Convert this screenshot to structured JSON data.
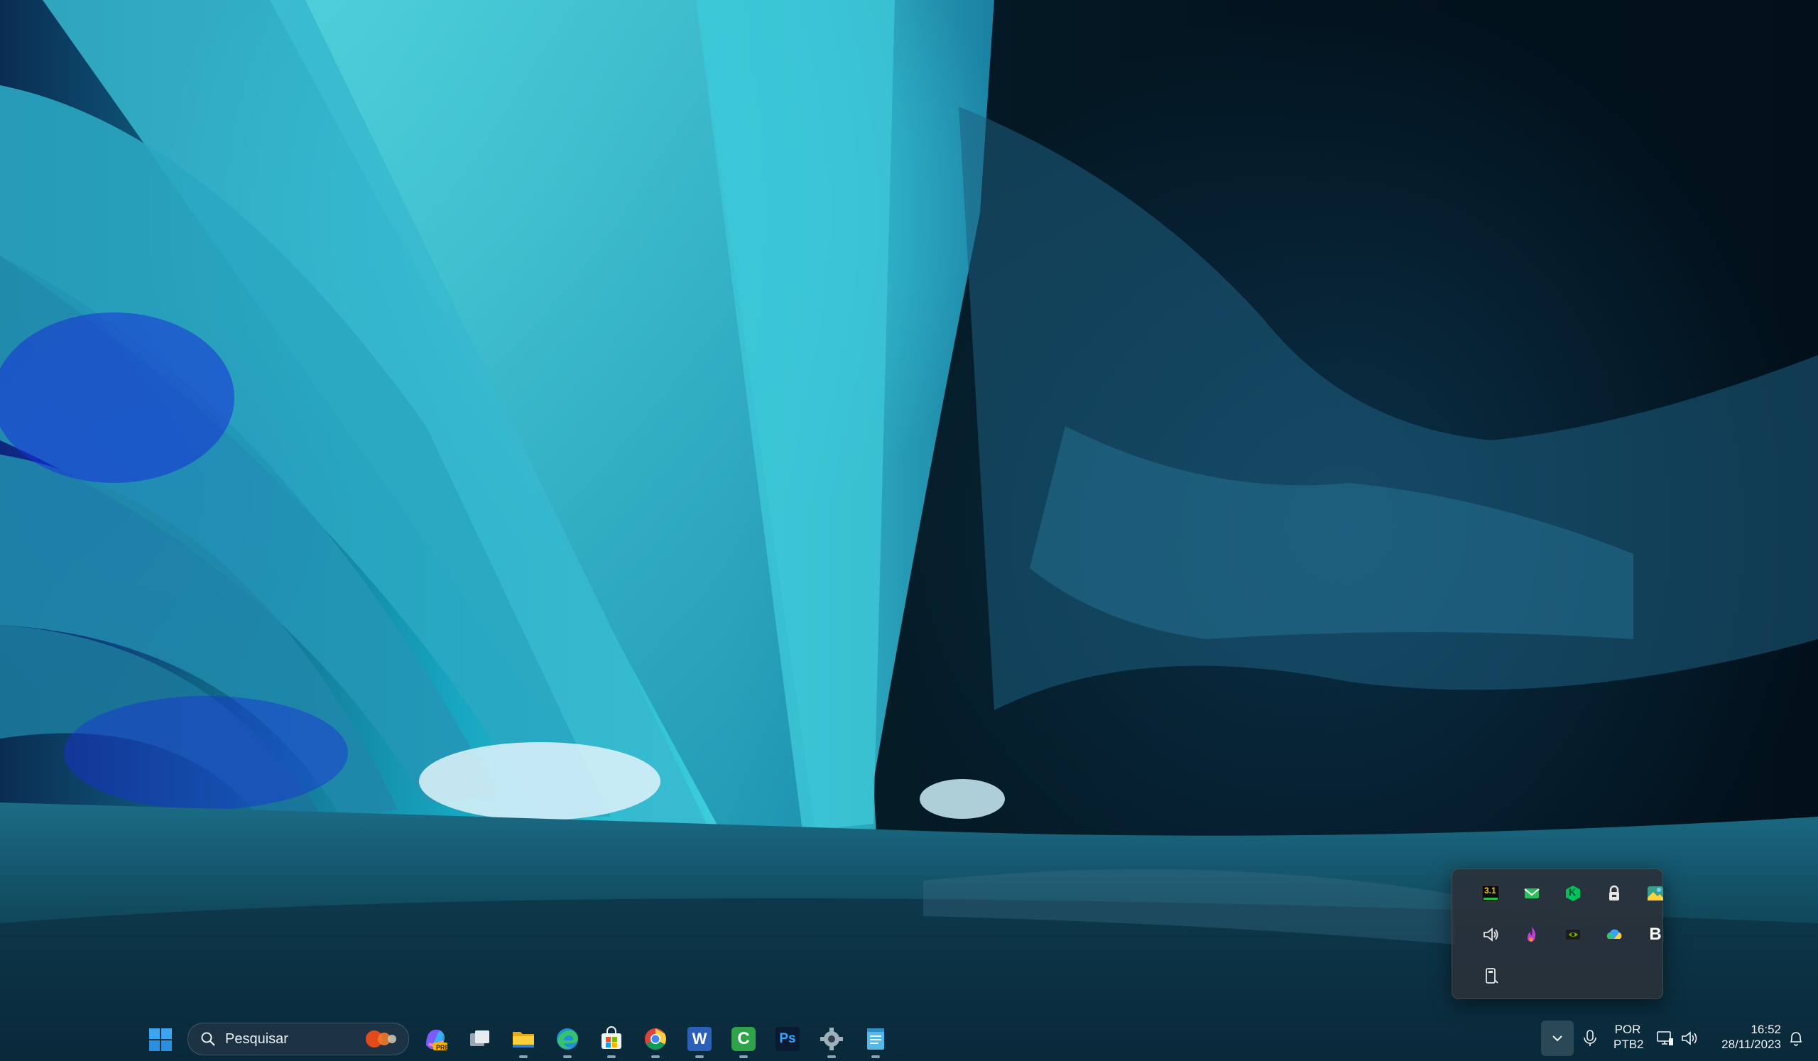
{
  "taskbar": {
    "search_placeholder": "Pesquisar",
    "pinned_apps": [
      {
        "name": "Copilot Preview",
        "icon": "copilot-pre-icon",
        "badge": "PRE"
      },
      {
        "name": "Task View",
        "icon": "task-view-icon"
      },
      {
        "name": "File Explorer",
        "icon": "folder-icon"
      },
      {
        "name": "Microsoft Edge",
        "icon": "edge-icon"
      },
      {
        "name": "Microsoft Store",
        "icon": "store-icon"
      },
      {
        "name": "Google Chrome",
        "icon": "chrome-icon"
      },
      {
        "name": "Microsoft Word",
        "icon": "word-icon",
        "label": "W"
      },
      {
        "name": "Camtasia",
        "icon": "camtasia-icon",
        "label": "C"
      },
      {
        "name": "Adobe Photoshop",
        "icon": "photoshop-icon",
        "label": "Ps"
      },
      {
        "name": "Settings",
        "icon": "gear-icon"
      },
      {
        "name": "Notepad",
        "icon": "notepad-icon"
      }
    ]
  },
  "tray_flyout": {
    "icons": [
      {
        "icon": "task-manager-icon",
        "label": "3.1"
      },
      {
        "icon": "mail-icon"
      },
      {
        "icon": "kaspersky-icon",
        "label": "K"
      },
      {
        "icon": "vpn-lock-icon"
      },
      {
        "icon": "photos-icon"
      },
      {
        "icon": "speaker-icon"
      },
      {
        "icon": "flame-app-icon"
      },
      {
        "icon": "nvidia-icon"
      },
      {
        "icon": "cloud-sync-icon"
      },
      {
        "icon": "bold-b-app-icon",
        "label": "B"
      },
      {
        "icon": "usb-drive-icon"
      }
    ]
  },
  "system_tray": {
    "language_line1": "POR",
    "language_line2": "PTB2",
    "time": "16:52",
    "date": "28/11/2023"
  },
  "colors": {
    "taskbar_text": "#f2f4f6",
    "flyout_bg": "#2a323a",
    "accent_blue": "#2b7fd9"
  }
}
